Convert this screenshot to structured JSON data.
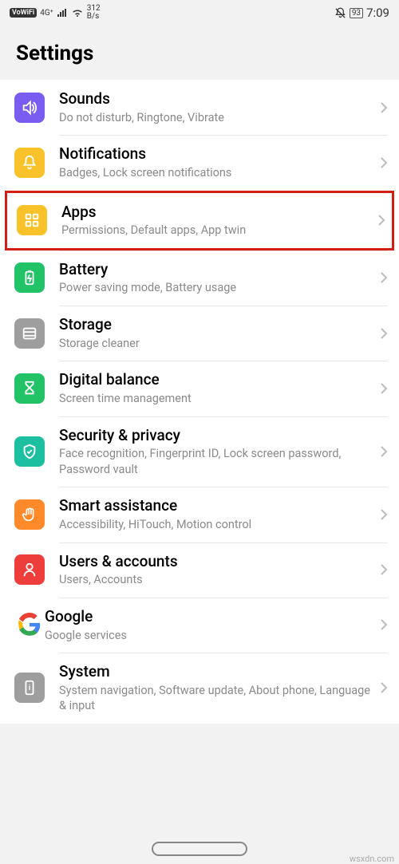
{
  "status": {
    "vowifi": "VoWiFi",
    "signal": "4G⁺",
    "speed_top": "312",
    "speed_bot": "B/s",
    "battery": "93",
    "time": "7:09"
  },
  "page_title": "Settings",
  "items": [
    {
      "title": "Sounds",
      "sub": "Do not disturb, Ringtone, Vibrate",
      "icon": "sound",
      "bg": "#7a5cf0",
      "highlight": false
    },
    {
      "title": "Notifications",
      "sub": "Badges, Lock screen notifications",
      "icon": "bell",
      "bg": "#f9c22b",
      "highlight": false
    },
    {
      "title": "Apps",
      "sub": "Permissions, Default apps, App twin",
      "icon": "grid",
      "bg": "#f9c22b",
      "highlight": true
    },
    {
      "title": "Battery",
      "sub": "Power saving mode, Battery usage",
      "icon": "battery",
      "bg": "#22c267",
      "highlight": false
    },
    {
      "title": "Storage",
      "sub": "Storage cleaner",
      "icon": "storage",
      "bg": "#9e9e9e",
      "highlight": false
    },
    {
      "title": "Digital balance",
      "sub": "Screen time management",
      "icon": "hourglass",
      "bg": "#22c267",
      "highlight": false
    },
    {
      "title": "Security & privacy",
      "sub": "Face recognition, Fingerprint ID, Lock screen password, Password vault",
      "icon": "shield",
      "bg": "#1cc0a0",
      "highlight": false
    },
    {
      "title": "Smart assistance",
      "sub": "Accessibility, HiTouch, Motion control",
      "icon": "hand",
      "bg": "#ff8a29",
      "highlight": false
    },
    {
      "title": "Users & accounts",
      "sub": "Users, Accounts",
      "icon": "user",
      "bg": "#ee3e3b",
      "highlight": false
    },
    {
      "title": "Google",
      "sub": "Google services",
      "icon": "google",
      "bg": "#ffffff",
      "highlight": false
    },
    {
      "title": "System",
      "sub": "System navigation, Software update, About phone, Language & input",
      "icon": "system",
      "bg": "#9e9e9e",
      "highlight": false
    }
  ],
  "watermark": "wsxdn.com"
}
